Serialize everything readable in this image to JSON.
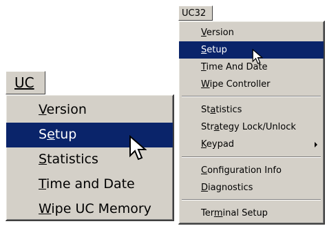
{
  "uc_menu": {
    "title": "UC",
    "items": [
      {
        "pre": "",
        "u": "V",
        "post": "ersion"
      },
      {
        "pre": "S",
        "u": "e",
        "post": "tup"
      },
      {
        "pre": "",
        "u": "S",
        "post": "tatistics"
      },
      {
        "pre": "",
        "u": "T",
        "post": "ime and Date"
      },
      {
        "pre": "",
        "u": "W",
        "post": "ipe UC Memory"
      }
    ],
    "selected": "Setup"
  },
  "uc32_menu": {
    "title": "UC32",
    "items": [
      {
        "pre": "",
        "u": "V",
        "post": "ersion"
      },
      {
        "pre": "",
        "u": "S",
        "post": "etup"
      },
      {
        "pre": "",
        "u": "T",
        "post": "ime And Date"
      },
      {
        "pre": "",
        "u": "W",
        "post": "ipe Controller"
      },
      {
        "pre": "St",
        "u": "a",
        "post": "tistics"
      },
      {
        "pre": "Str",
        "u": "a",
        "post": "tegy Lock/Unlock"
      },
      {
        "pre": "",
        "u": "K",
        "post": "eypad"
      },
      {
        "pre": "",
        "u": "C",
        "post": "onfiguration Info"
      },
      {
        "pre": "",
        "u": "D",
        "post": "iagnostics"
      },
      {
        "pre": "Ter",
        "u": "m",
        "post": "inal Setup"
      }
    ],
    "selected": "Setup"
  },
  "icons": [
    "mouse-pointer-icon",
    "submenu-arrow-icon"
  ],
  "colors": {
    "menu_bg": "#d4d0c8",
    "highlight_bg": "#0a246a",
    "highlight_text": "#ffffff"
  }
}
